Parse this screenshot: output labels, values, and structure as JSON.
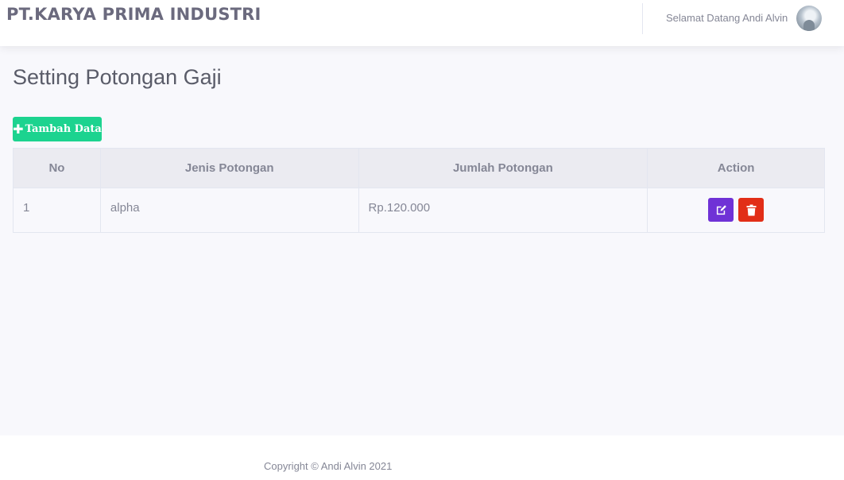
{
  "header": {
    "brand": "PT.KARYA PRIMA INDUSTRI",
    "welcome": "Selamat Datang Andi Alvin"
  },
  "page": {
    "title": "Setting Potongan Gaji",
    "add_button_label": "Tambah Data"
  },
  "table": {
    "columns": [
      "No",
      "Jenis Potongan",
      "Jumlah Potongan",
      "Action"
    ],
    "rows": [
      {
        "no": "1",
        "jenis": "alpha",
        "jumlah": "Rp.120.000"
      }
    ]
  },
  "footer": {
    "copyright": "Copyright © Andi Alvin 2021"
  },
  "icons": {
    "add": "plus-icon",
    "edit": "edit-icon",
    "delete": "trash-icon"
  },
  "colors": {
    "add_button": "#1cd38f",
    "edit_button": "#6f32d6",
    "delete_button": "#e22e17"
  }
}
